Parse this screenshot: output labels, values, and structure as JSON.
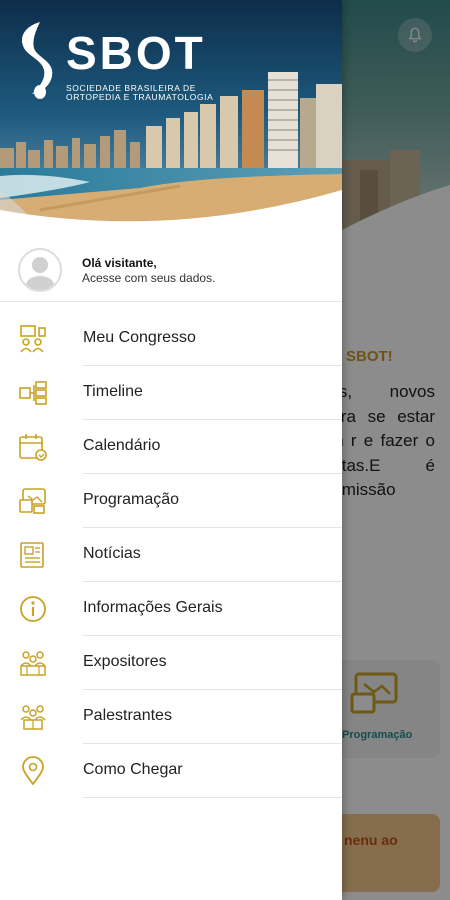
{
  "drawer": {
    "logo": {
      "name": "SBOT",
      "subtitle_line1": "SOCIEDADE BRASILEIRA DE",
      "subtitle_line2": "ORTOPEDIA E TRAUMATOLOGIA"
    },
    "user": {
      "greeting": "Olá visitante,",
      "subtitle": "Acesse com seus dados."
    },
    "menu": [
      {
        "label": "Meu Congresso",
        "icon": "congress-icon"
      },
      {
        "label": "Timeline",
        "icon": "timeline-icon"
      },
      {
        "label": "Calendário",
        "icon": "calendar-icon"
      },
      {
        "label": "Programação",
        "icon": "schedule-icon"
      },
      {
        "label": "Notícias",
        "icon": "news-icon"
      },
      {
        "label": "Informações Gerais",
        "icon": "info-icon"
      },
      {
        "label": "Expositores",
        "icon": "exhibitors-icon"
      },
      {
        "label": "Palestrantes",
        "icon": "speakers-icon"
      },
      {
        "label": "Como Chegar",
        "icon": "location-pin-icon"
      }
    ]
  },
  "background": {
    "welcome": "SBOT!",
    "paragraph": "des, novos Para se estar em r e fazer o distas.E é Comissão",
    "card_label": "Programação",
    "banner_text": "nenu ao"
  },
  "colors": {
    "accent": "#c9a227",
    "brand_teal": "#2a8a8a"
  }
}
